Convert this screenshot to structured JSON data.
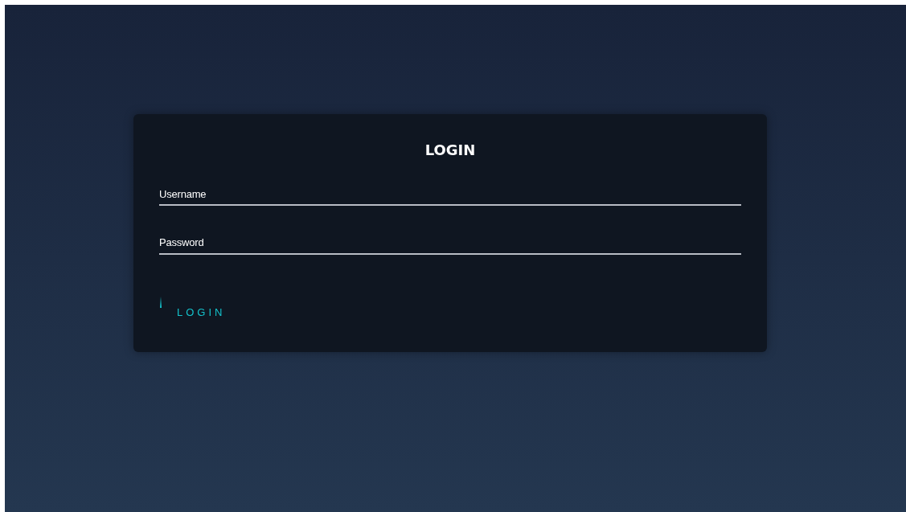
{
  "title": "LOGIN",
  "fields": [
    {
      "placeholder": "Username"
    },
    {
      "placeholder": "Password"
    }
  ],
  "button": {
    "label": "LOGIN"
  }
}
